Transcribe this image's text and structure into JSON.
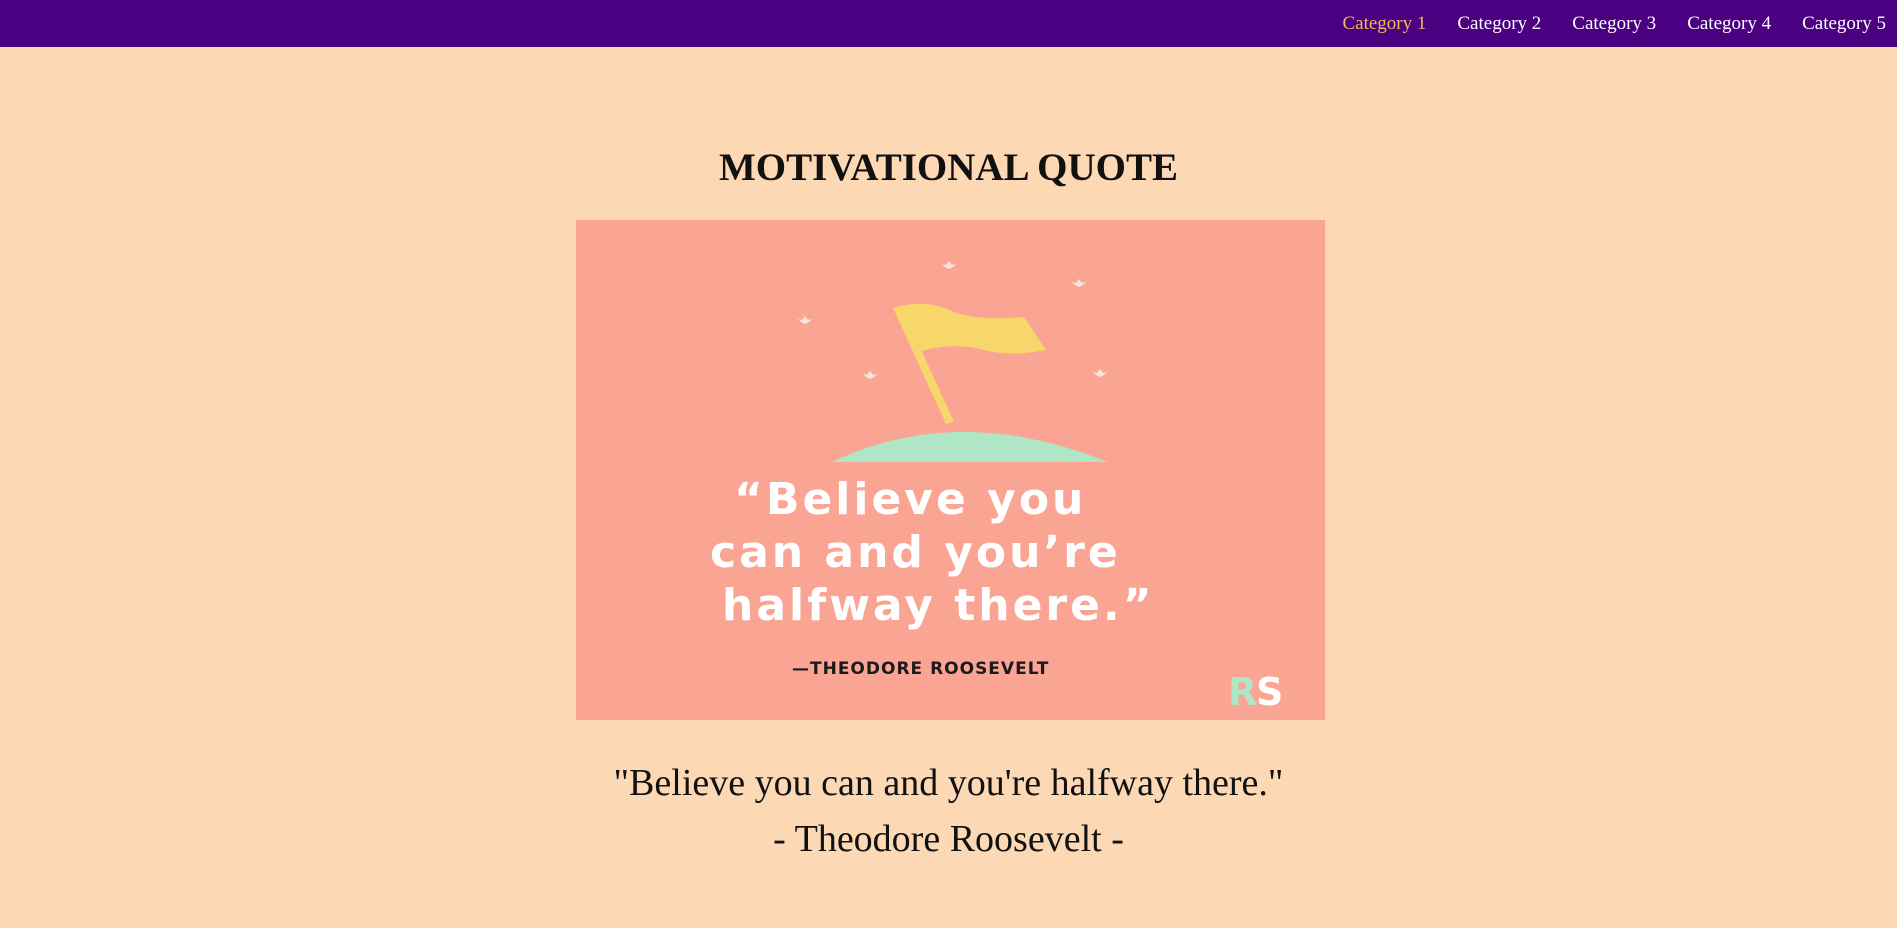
{
  "nav": {
    "items": [
      {
        "label": "Category 1",
        "active": true
      },
      {
        "label": "Category 2",
        "active": false
      },
      {
        "label": "Category 3",
        "active": false
      },
      {
        "label": "Category 4",
        "active": false
      },
      {
        "label": "Category 5",
        "active": false
      }
    ]
  },
  "page": {
    "title": "MOTIVATIONAL QUOTE"
  },
  "poster": {
    "quote_lines": [
      "“Believe you",
      "can and you’re",
      "halfway there.”"
    ],
    "attribution": "—THEODORE ROOSEVELT",
    "logo": "RS",
    "icon": "flag-on-hill-icon"
  },
  "quote": {
    "text": "\"Believe you can and you're halfway there.\"",
    "author": "- Theodore Roosevelt -"
  },
  "colors": {
    "background": "#FDD8B5",
    "nav_background": "#4B0082",
    "nav_active": "#F7B85B",
    "poster_background": "#FAA494",
    "flag": "#F7D66A",
    "hill": "#AEE6C6"
  }
}
